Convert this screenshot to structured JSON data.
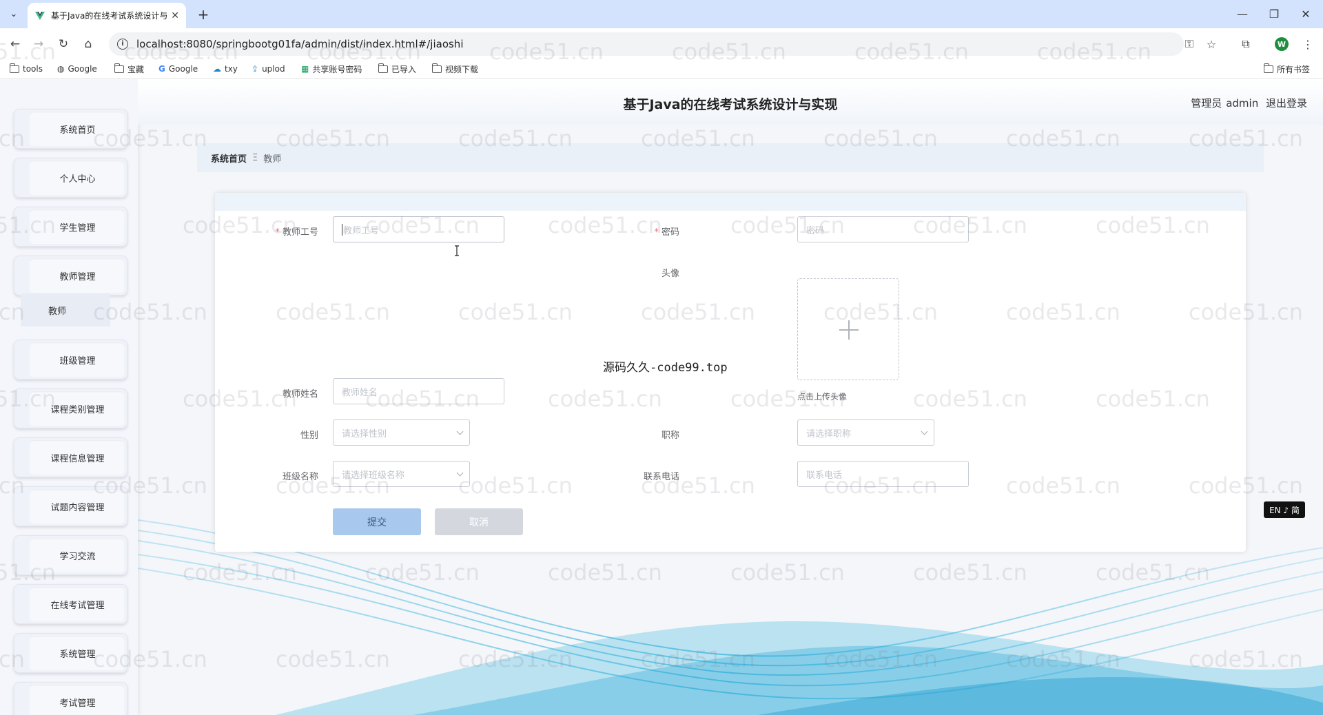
{
  "browser": {
    "tab_title": "基于Java的在线考试系统设计与",
    "url": "localhost:8080/springbootg01fa/admin/dist/index.html#/jiaoshi",
    "profile_initial": "W",
    "bookmarks": [
      "tools",
      "Google",
      "宝藏",
      "Google",
      "txy",
      "uplod",
      "共享账号密码",
      "已导入",
      "视频下载"
    ],
    "all_bookmarks": "所有书签"
  },
  "header": {
    "title": "基于Java的在线考试系统设计与实现",
    "role": "管理员",
    "username": "admin",
    "logout": "退出登录"
  },
  "sidebar": {
    "items": [
      "系统首页",
      "个人中心",
      "学生管理",
      "教师管理",
      "班级管理",
      "课程类别管理",
      "课程信息管理",
      "试题内容管理",
      "学习交流",
      "在线考试管理",
      "系统管理",
      "考试管理"
    ],
    "submenu_teacher": "教师"
  },
  "breadcrumb": {
    "home": "系统首页",
    "separator": "Ξ",
    "current": "教师"
  },
  "form": {
    "teacher_id_label": "教师工号",
    "teacher_id_placeholder": "教师工号",
    "password_label": "密码",
    "password_placeholder": "密码",
    "avatar_label": "头像",
    "avatar_tip": "点击上传头像",
    "teacher_name_label": "教师姓名",
    "teacher_name_placeholder": "教师姓名",
    "gender_label": "性别",
    "gender_placeholder": "请选择性别",
    "title_label": "职称",
    "title_placeholder": "请选择职称",
    "class_label": "班级名称",
    "class_placeholder": "请选择班级名称",
    "phone_label": "联系电话",
    "phone_placeholder": "联系电话",
    "submit": "提交",
    "cancel": "取消",
    "required_mark": "*"
  },
  "overlay": {
    "source_text": "源码久久-code99.top",
    "lang_toggle": "EN ♪ 简",
    "watermark": "code51.cn"
  },
  "colors": {
    "accent": "#a9c8ee",
    "required": "#f56c6c",
    "wave": "#3bb4dc"
  }
}
